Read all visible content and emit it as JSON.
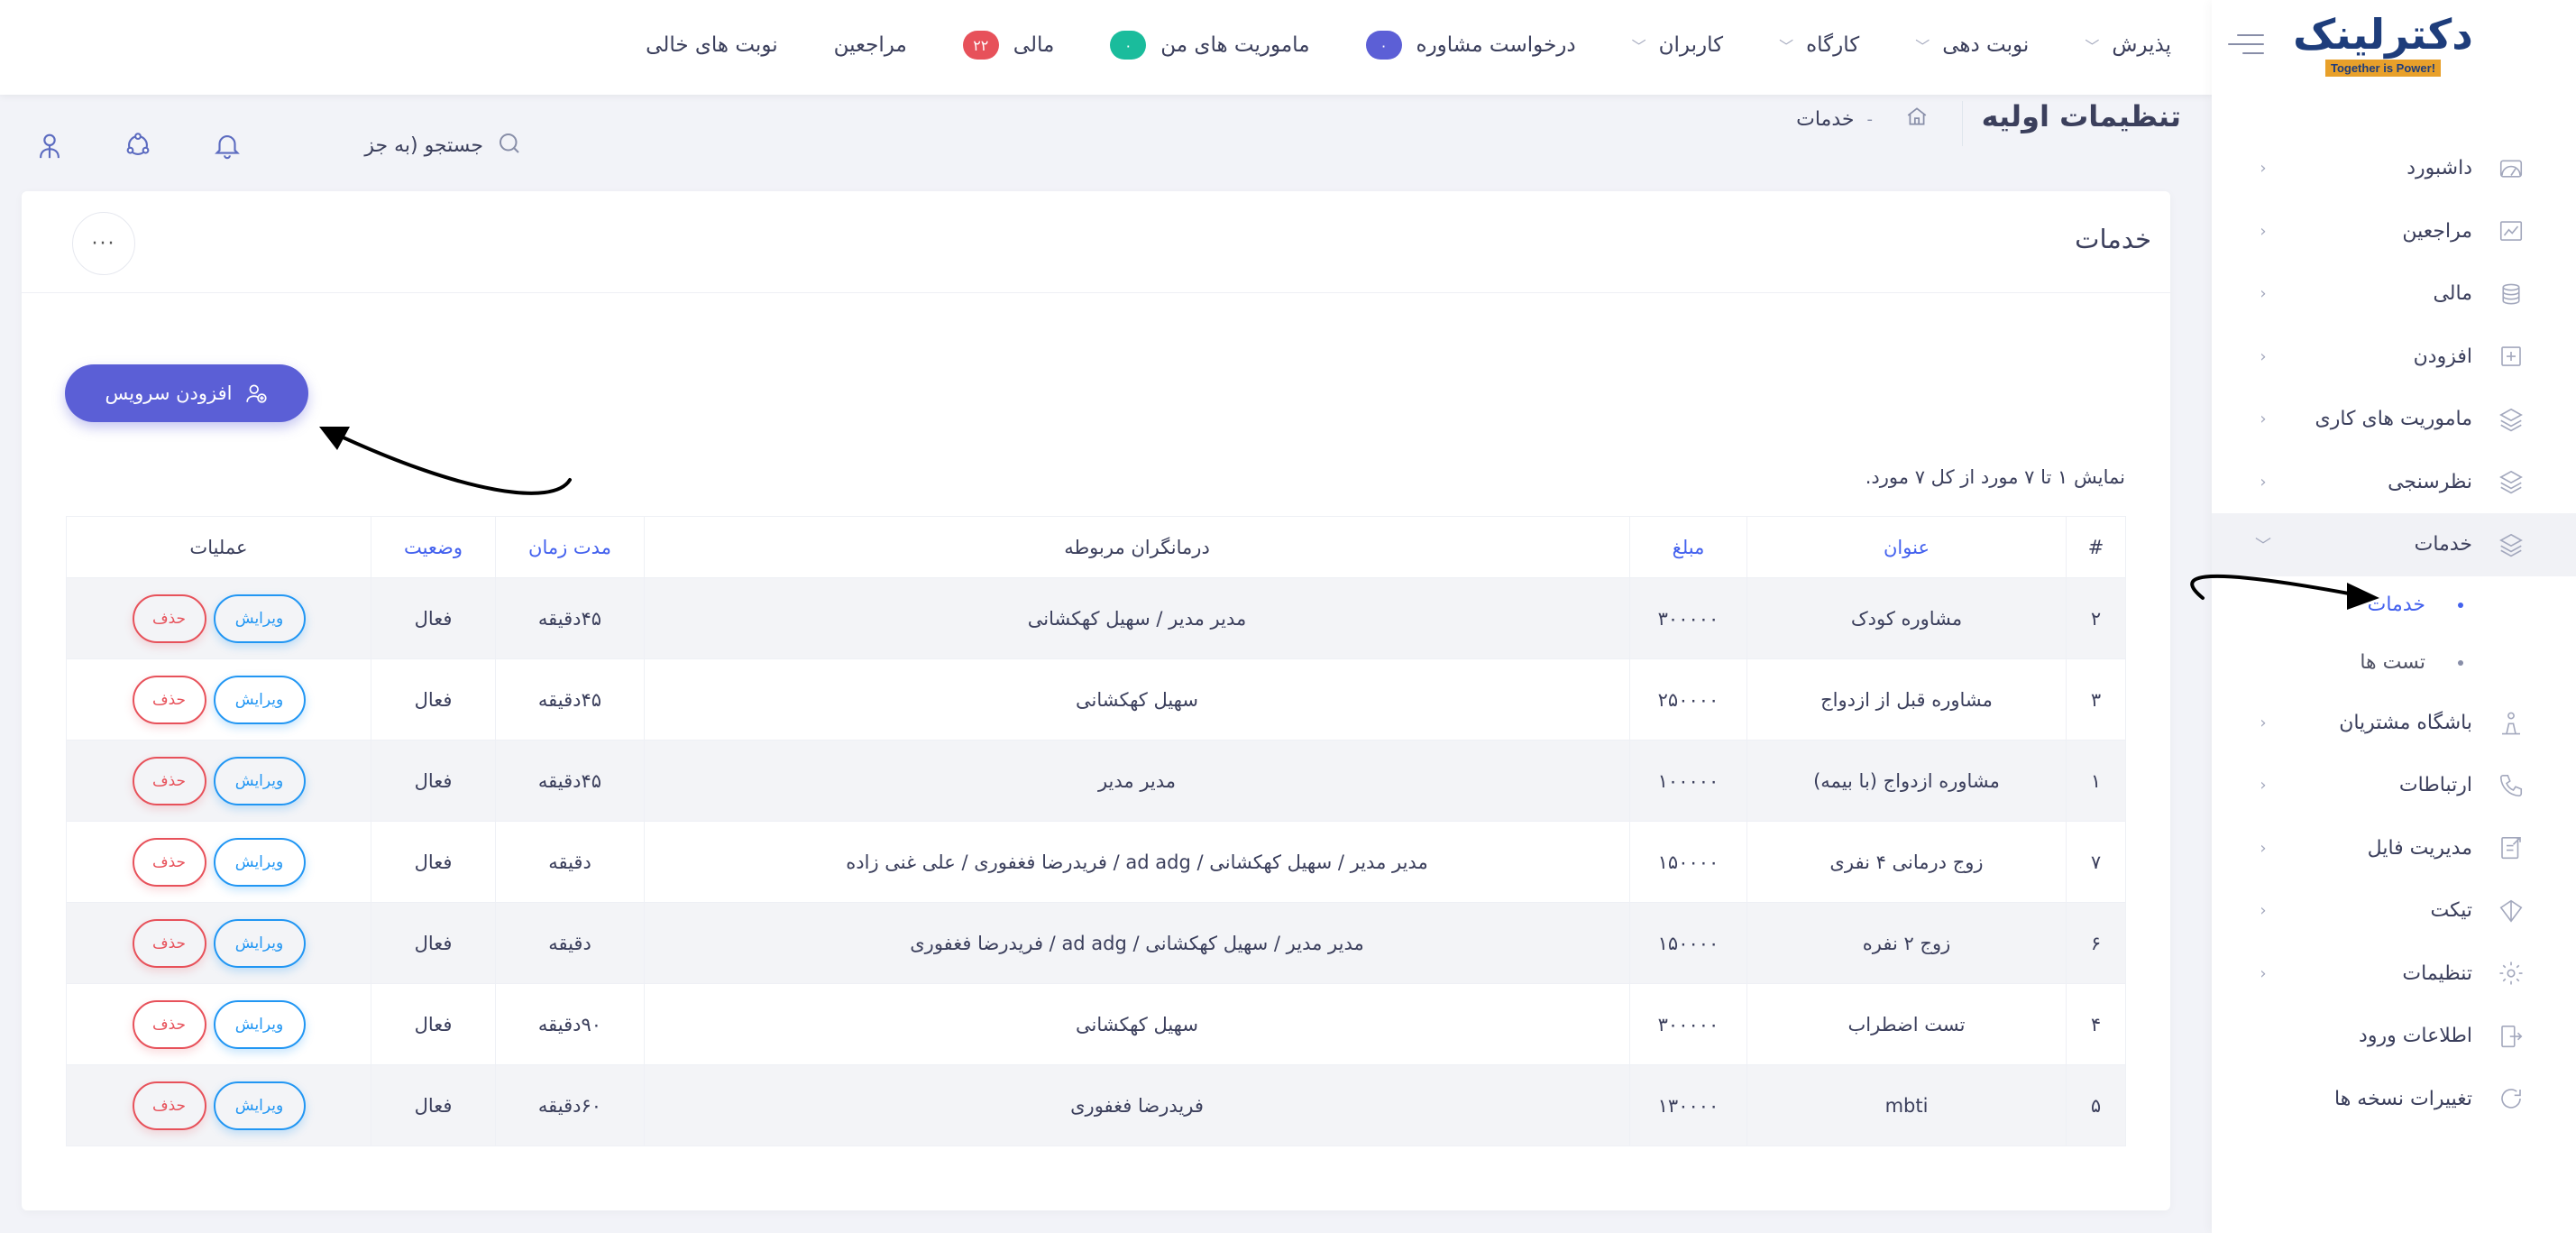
{
  "brand": {
    "logo_text": "دکترلینک",
    "logo_tagline": "Together is Power!"
  },
  "colors": {
    "accent": "#5b5fd6",
    "link_blue": "#4361ee",
    "danger": "#e7515a",
    "info": "#2196f3",
    "badge_purple": "#5c5fd6",
    "badge_green": "#1abc9c",
    "badge_red": "#e7515a"
  },
  "topnav": {
    "items": [
      {
        "label": "پذیرش",
        "has_chevron": true
      },
      {
        "label": "نوبت دهی",
        "has_chevron": true
      },
      {
        "label": "کارگاه",
        "has_chevron": true
      },
      {
        "label": "کاربران",
        "has_chevron": true
      },
      {
        "label": "درخواست مشاوره",
        "badge": "۰",
        "badge_color": "purple"
      },
      {
        "label": "ماموریت های من",
        "badge": "۰",
        "badge_color": "green"
      },
      {
        "label": "مالی",
        "badge": "۲۲",
        "badge_color": "red"
      },
      {
        "label": "مراجعین"
      },
      {
        "label": "نوبت های خالی"
      }
    ]
  },
  "sidebar": {
    "items": [
      {
        "label": "داشبورد",
        "icon": "dashboard-icon"
      },
      {
        "label": "مراجعین",
        "icon": "chart-icon"
      },
      {
        "label": "مالی",
        "icon": "money-icon"
      },
      {
        "label": "افزودن",
        "icon": "plus-square-icon"
      },
      {
        "label": "ماموریت های کاری",
        "icon": "layers-icon"
      },
      {
        "label": "نظرسنجی",
        "icon": "layers-icon"
      },
      {
        "label": "خدمات",
        "icon": "layers-icon",
        "expanded": true
      }
    ],
    "sub_items": [
      {
        "label": "خدمات",
        "active": true
      },
      {
        "label": "تست ها"
      }
    ],
    "items_after": [
      {
        "label": "باشگاه مشتریان",
        "icon": "club-icon"
      },
      {
        "label": "ارتباطات",
        "icon": "phone-icon"
      },
      {
        "label": "مدیریت فایل",
        "icon": "file-icon"
      },
      {
        "label": "تیکت",
        "icon": "ticket-icon"
      },
      {
        "label": "تنظیمات",
        "icon": "gear-icon"
      },
      {
        "label": "اطلاعات ورود",
        "icon": "login-icon",
        "no_chevron": true
      },
      {
        "label": "تغییرات نسخه ها",
        "icon": "refresh-icon",
        "no_chevron": true
      }
    ]
  },
  "header": {
    "title": "تنظیمات اولیه",
    "breadcrumb_current": "خدمات",
    "breadcrumb_sep": "-",
    "search_placeholder": "جستجو (به جز"
  },
  "card": {
    "title": "خدمات",
    "more_label": "···",
    "add_button": "افزودن سرویس",
    "info": "نمایش ۱ تا ۷ مورد از کل ۷ مورد."
  },
  "table": {
    "headers": {
      "num": "#",
      "title": "عنوان",
      "price": "مبلغ",
      "therapists": "درمانگران مربوطه",
      "duration": "مدت زمان",
      "status": "وضعیت",
      "ops": "عملیات"
    },
    "edit_label": "ویرایش",
    "delete_label": "حذف",
    "rows": [
      {
        "num": "۲",
        "title": "مشاوره کودک",
        "price": "۳۰۰۰۰۰",
        "therapists": "مدیر مدیر / سهیل کهکشانی",
        "duration": "۴۵دقیقه",
        "status": "فعال"
      },
      {
        "num": "۳",
        "title": "مشاوره قبل از ازدواج",
        "price": "۲۵۰۰۰۰",
        "therapists": "سهیل کهکشانی",
        "duration": "۴۵دقیقه",
        "status": "فعال"
      },
      {
        "num": "۱",
        "title": "مشاوره ازدواج (با بیمه)",
        "price": "۱۰۰۰۰۰",
        "therapists": "مدیر مدیر",
        "duration": "۴۵دقیقه",
        "status": "فعال"
      },
      {
        "num": "۷",
        "title": "زوج درمانی ۴ نفری",
        "price": "۱۵۰۰۰۰",
        "therapists": "مدیر مدیر / سهیل کهکشانی / ad adg / فریدرضا فغفوری / علی غنی زاده",
        "duration": "دقیقه",
        "status": "فعال"
      },
      {
        "num": "۶",
        "title": "زوج ۲ نفره",
        "price": "۱۵۰۰۰۰",
        "therapists": "مدیر مدیر / سهیل کهکشانی / ad adg / فریدرضا فغفوری",
        "duration": "دقیقه",
        "status": "فعال"
      },
      {
        "num": "۴",
        "title": "تست اضطراب",
        "price": "۳۰۰۰۰۰",
        "therapists": "سهیل کهکشانی",
        "duration": "۹۰دقیقه",
        "status": "فعال"
      },
      {
        "num": "۵",
        "title": "mbti",
        "price": "۱۳۰۰۰۰",
        "therapists": "فریدرضا فغفوری",
        "duration": "۶۰دقیقه",
        "status": "فعال"
      }
    ]
  }
}
